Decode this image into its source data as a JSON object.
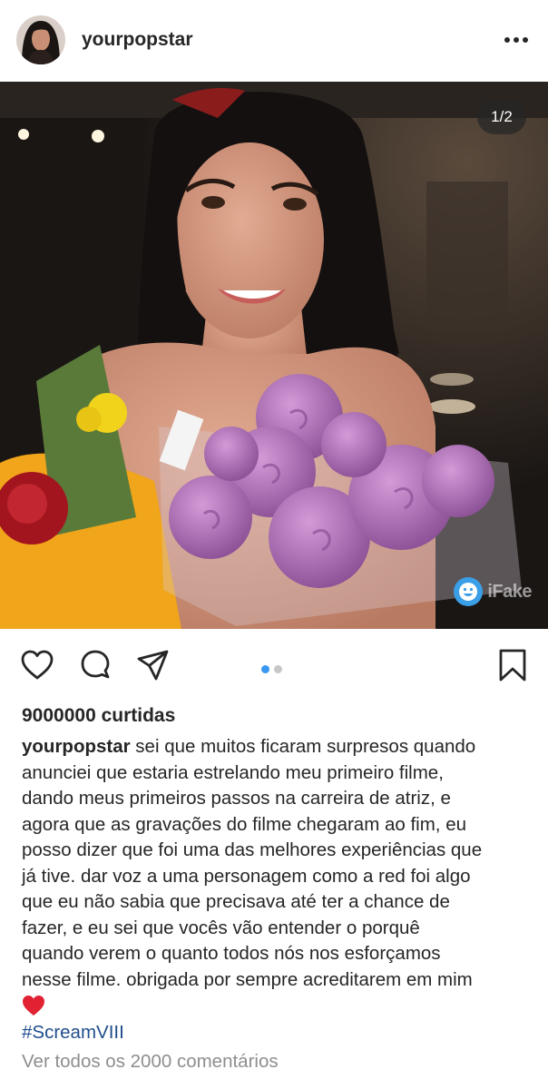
{
  "post": {
    "username": "yourpopstar",
    "slide_counter": "1/2",
    "watermark": "iFake",
    "likes": "9000000 curtidas",
    "caption_user": "yourpopstar",
    "caption_lines": [
      " sei que muitos ficaram surpresos quando",
      "anunciei que estaria estrelando meu primeiro filme,",
      "dando meus primeiros passos na carreira de atriz, e",
      "agora que as gravações do filme chegaram ao fim, eu",
      "posso dizer que foi uma das melhores experiências que",
      "já tive. dar voz a uma personagem como a red foi algo",
      "que eu não sabia que precisava até ter a chance de",
      "fazer, e eu sei que vocês vão entender o porquê",
      "quando verem o quanto todos nós nos esforçamos",
      "nesse filme. obrigada por sempre acreditarem em mim"
    ],
    "caption_emoji": "red-heart-emoji",
    "hashtag": "#ScreamVIII",
    "view_comments": "Ver todos os 2000 comentários"
  },
  "carousel": {
    "total": 2,
    "active_index": 0,
    "active_color": "#3897f0",
    "inactive_color": "#c7c7c7"
  },
  "icons": [
    "avatar",
    "more-options-icon",
    "like-heart-icon",
    "comment-icon",
    "share-icon",
    "save-bookmark-icon",
    "smiley-icon"
  ]
}
